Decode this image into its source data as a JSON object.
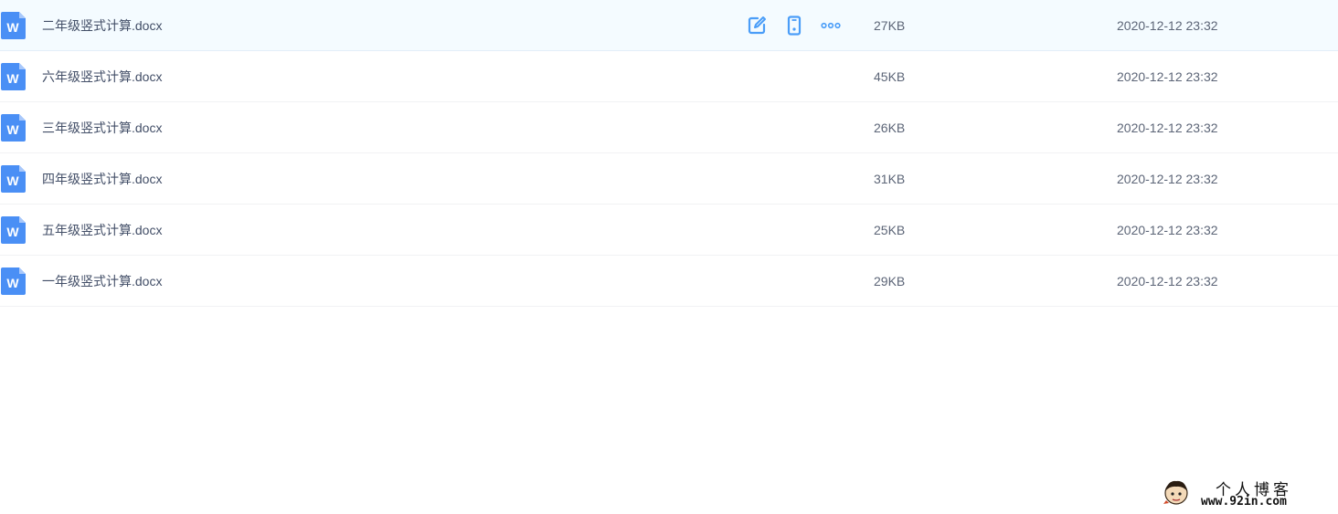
{
  "files": [
    {
      "name": "二年级竖式计算.docx",
      "size": "27KB",
      "date": "2020-12-12 23:32",
      "icon": "word-doc-icon"
    },
    {
      "name": "六年级竖式计算.docx",
      "size": "45KB",
      "date": "2020-12-12 23:32",
      "icon": "word-doc-icon"
    },
    {
      "name": "三年级竖式计算.docx",
      "size": "26KB",
      "date": "2020-12-12 23:32",
      "icon": "word-doc-icon"
    },
    {
      "name": "四年级竖式计算.docx",
      "size": "31KB",
      "date": "2020-12-12 23:32",
      "icon": "word-doc-icon"
    },
    {
      "name": "五年级竖式计算.docx",
      "size": "25KB",
      "date": "2020-12-12 23:32",
      "icon": "word-doc-icon"
    },
    {
      "name": "一年级竖式计算.docx",
      "size": "29KB",
      "date": "2020-12-12 23:32",
      "icon": "word-doc-icon"
    }
  ],
  "row_actions": {
    "icons": [
      "edit-icon",
      "phone-icon",
      "more-icon"
    ]
  },
  "watermark": {
    "title": "个人博客",
    "url": "www.92in.com"
  },
  "colors": {
    "accent": "#4a9df8",
    "hover_row": "#f4fbff",
    "word_icon": "#4a8ff5"
  }
}
